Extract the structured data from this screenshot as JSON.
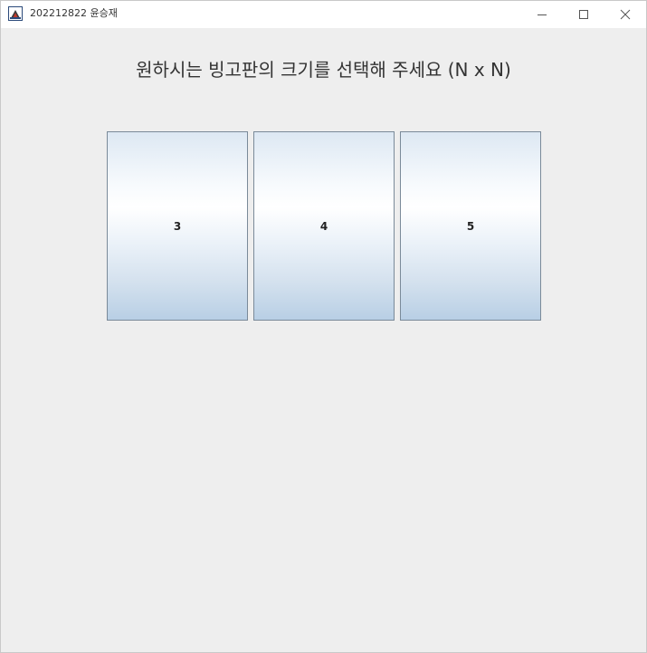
{
  "window": {
    "title": "202212822 윤승재",
    "icon": "java-app-icon",
    "controls": {
      "minimize_icon": "minimize-icon",
      "maximize_icon": "maximize-icon",
      "close_icon": "close-icon"
    }
  },
  "main": {
    "prompt": "원하시는 빙고판의 크기를 선택해 주세요 (N x N)",
    "size_options": [
      {
        "label": "3"
      },
      {
        "label": "4"
      },
      {
        "label": "5"
      }
    ]
  },
  "colors": {
    "background": "#eeeeee",
    "titlebar": "#ffffff",
    "button_border": "#7a8a99",
    "button_gradient_bottom": "#b8cfe5"
  }
}
